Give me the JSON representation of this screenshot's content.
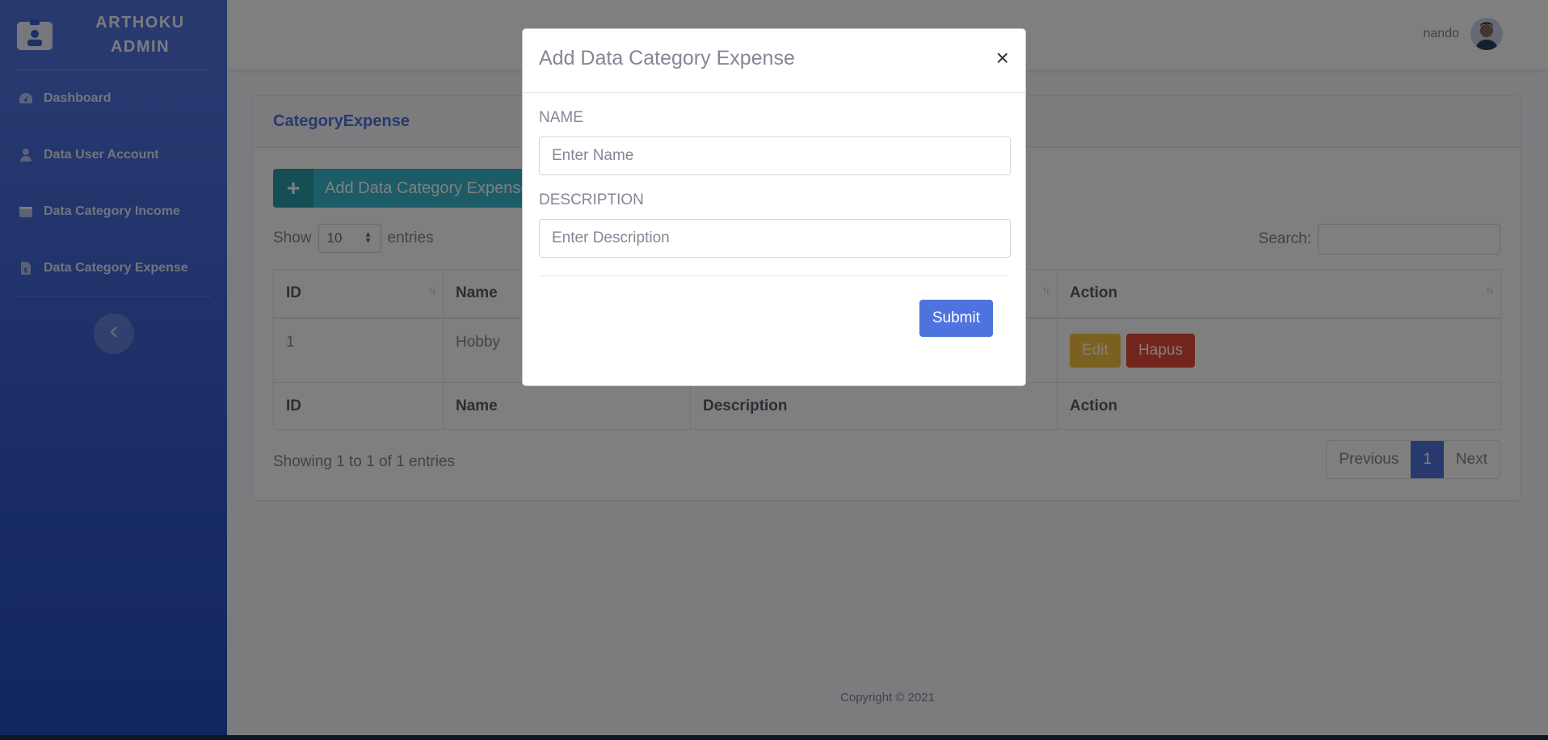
{
  "brand": {
    "line1": "ARTHOKU",
    "line2": "ADMIN"
  },
  "sidebar": {
    "items": [
      {
        "label": "Dashboard",
        "icon": "tachometer-icon"
      },
      {
        "label": "Data User Account",
        "icon": "user-icon"
      },
      {
        "label": "Data Category Income",
        "icon": "wallet-icon"
      },
      {
        "label": "Data Category Expense",
        "icon": "file-invoice-icon"
      }
    ]
  },
  "topbar": {
    "username": "nando"
  },
  "card": {
    "title": "CategoryExpense",
    "add_button_label": "Add Data Category Expense",
    "show_label": "Show",
    "entries_label": "entries",
    "page_size": "10",
    "search_label": "Search:",
    "columns": [
      "ID",
      "Name",
      "Description",
      "Action"
    ],
    "rows": [
      {
        "id": "1",
        "name": "Hobby",
        "description": ""
      }
    ],
    "edit_label": "Edit",
    "delete_label": "Hapus",
    "info": "Showing 1 to 1 of 1 entries",
    "pagination": {
      "previous": "Previous",
      "current": "1",
      "next": "Next"
    }
  },
  "footer": {
    "text": "Copyright © 2021"
  },
  "modal": {
    "title": "Add Data Category Expense",
    "close_symbol": "×",
    "name_label": "NAME",
    "name_placeholder": "Enter Name",
    "description_label": "DESCRIPTION",
    "description_placeholder": "Enter Description",
    "submit_label": "Submit"
  },
  "colors": {
    "primary": "#4e73df",
    "info": "#36b9cc",
    "warning": "#f6c23e",
    "danger": "#e74a3b"
  }
}
